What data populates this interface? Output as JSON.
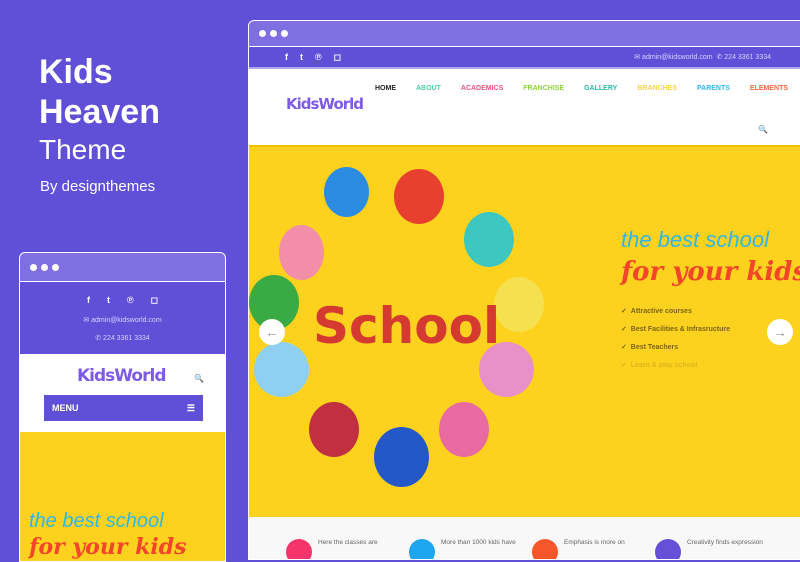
{
  "promo": {
    "title_line1": "Kids",
    "title_line2": "Heaven",
    "subtitle": "Theme",
    "byline": "By designthemes"
  },
  "site": {
    "email": "admin@kidsworld.com",
    "phone": "224 3361 3334",
    "logo": "KidsWorld",
    "social_icons": [
      "facebook-icon",
      "twitter-icon",
      "pinterest-icon",
      "instagram-icon"
    ],
    "nav": [
      {
        "label": "HOME",
        "color": "#222222"
      },
      {
        "label": "ABOUT",
        "color": "#4fd1a5"
      },
      {
        "label": "ACADEMICS",
        "color": "#e8567f"
      },
      {
        "label": "FRANCHISE",
        "color": "#8fd33a"
      },
      {
        "label": "GALLERY",
        "color": "#2bb9a8"
      },
      {
        "label": "BRANCHES",
        "color": "#fcd34d"
      },
      {
        "label": "PARENTS",
        "color": "#35b8f0"
      },
      {
        "label": "ELEMENTS",
        "color": "#f5673e"
      }
    ],
    "menu_label": "MENU",
    "hero": {
      "line1": "the best school",
      "line2": "for your kids",
      "image_text": "School",
      "checks": [
        "Attractive courses",
        "Best Facilities & Infrasructure",
        "Best Teachers",
        "Learn & play school"
      ]
    },
    "features": [
      {
        "text": "Here the classes are",
        "color": "#f5346b"
      },
      {
        "text": "More than 1000 kids have",
        "color": "#1ea7f0"
      },
      {
        "text": "Emphasis is more on",
        "color": "#f5562a"
      },
      {
        "text": "Creativity finds expression",
        "color": "#6650d8"
      }
    ]
  },
  "colors": {
    "brand": "#604fd7",
    "hero": "#fdd21f",
    "line1": "#2fb6e6",
    "line2": "#f2452a"
  }
}
